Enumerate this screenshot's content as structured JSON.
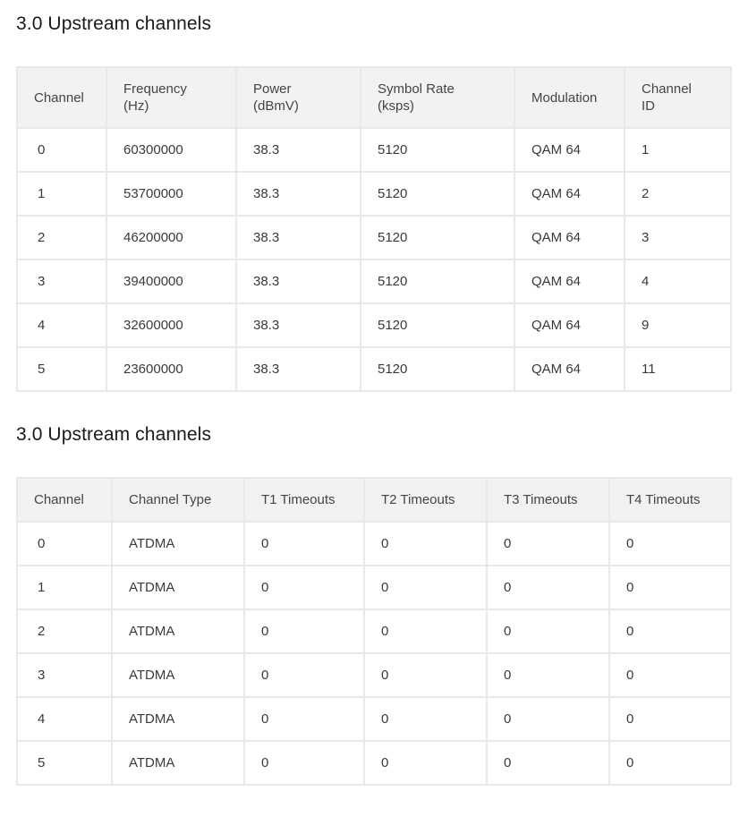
{
  "upstream": {
    "title": "3.0 Upstream channels",
    "columns": [
      [
        "Channel"
      ],
      [
        "Frequency",
        "(Hz)"
      ],
      [
        "Power",
        "(dBmV)"
      ],
      [
        "Symbol Rate",
        "(ksps)"
      ],
      [
        "Modulation"
      ],
      [
        "Channel",
        "ID"
      ]
    ],
    "rows": [
      [
        "0",
        "60300000",
        "38.3",
        "5120",
        "QAM 64",
        "1"
      ],
      [
        "1",
        "53700000",
        "38.3",
        "5120",
        "QAM 64",
        "2"
      ],
      [
        "2",
        "46200000",
        "38.3",
        "5120",
        "QAM 64",
        "3"
      ],
      [
        "3",
        "39400000",
        "38.3",
        "5120",
        "QAM 64",
        "4"
      ],
      [
        "4",
        "32600000",
        "38.3",
        "5120",
        "QAM 64",
        "9"
      ],
      [
        "5",
        "23600000",
        "38.3",
        "5120",
        "QAM 64",
        "11"
      ]
    ]
  },
  "timeouts": {
    "title": "3.0 Upstream channels",
    "columns": [
      [
        "Channel"
      ],
      [
        "Channel Type"
      ],
      [
        "T1 Timeouts"
      ],
      [
        "T2 Timeouts"
      ],
      [
        "T3 Timeouts"
      ],
      [
        "T4 Timeouts"
      ]
    ],
    "rows": [
      [
        "0",
        "ATDMA",
        "0",
        "0",
        "0",
        "0"
      ],
      [
        "1",
        "ATDMA",
        "0",
        "0",
        "0",
        "0"
      ],
      [
        "2",
        "ATDMA",
        "0",
        "0",
        "0",
        "0"
      ],
      [
        "3",
        "ATDMA",
        "0",
        "0",
        "0",
        "0"
      ],
      [
        "4",
        "ATDMA",
        "0",
        "0",
        "0",
        "0"
      ],
      [
        "5",
        "ATDMA",
        "0",
        "0",
        "0",
        "0"
      ]
    ]
  }
}
